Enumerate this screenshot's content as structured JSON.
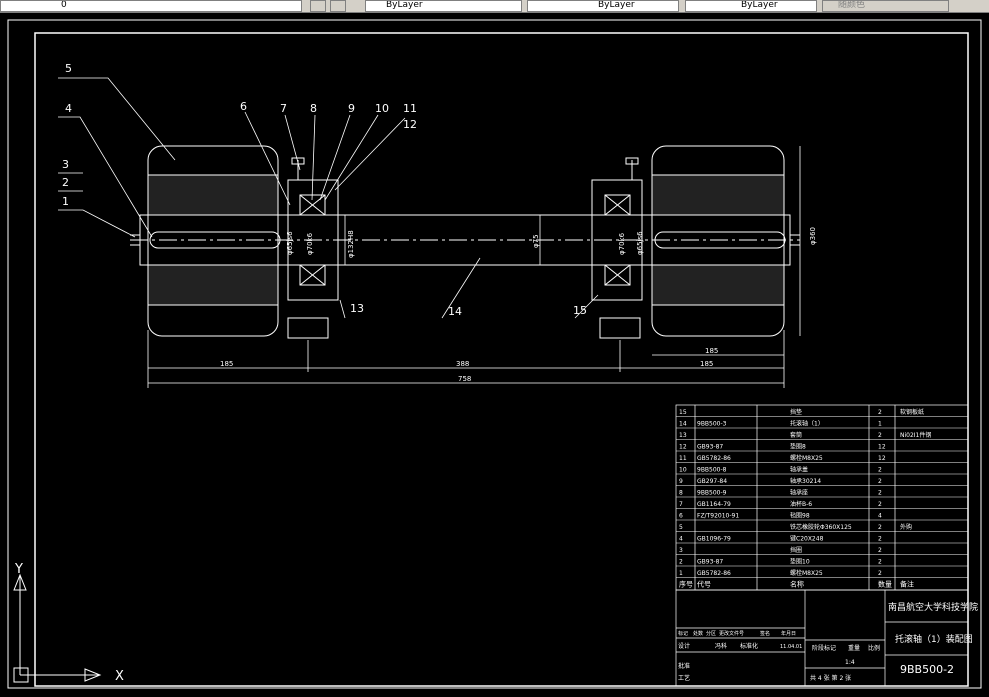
{
  "toolbar": {
    "layer_value": "0",
    "color_value": "ByLayer",
    "linetype_value": "ByLayer",
    "lineweight_value": "ByLayer",
    "plotstyle_value": "随颜色"
  },
  "callouts": [
    "1",
    "2",
    "3",
    "4",
    "5",
    "6",
    "7",
    "8",
    "9",
    "10",
    "11",
    "12",
    "13",
    "14",
    "15"
  ],
  "dimensions": {
    "d_left_bore": "φ65js6",
    "d_left_shaft": "φ70k6",
    "d_center": "φ132H8",
    "d_right_mid": "φ75",
    "d_right_shaft": "φ70k6",
    "d_right_bore": "φ65js6",
    "d_wheel": "φ360",
    "len_left": "185",
    "len_mid": "388",
    "len_right": "185",
    "len_total": "758"
  },
  "parts_list": {
    "rows": [
      {
        "no": "15",
        "code": "",
        "name": "挡垫",
        "qty": "2",
        "material": "软钢板纸"
      },
      {
        "no": "14",
        "code": "9BB500-3",
        "name": "托滚轴（1）",
        "qty": "1",
        "material": ""
      },
      {
        "no": "13",
        "code": "",
        "name": "套筒",
        "qty": "2",
        "material": "Ni02I1件钢"
      },
      {
        "no": "12",
        "code": "GB93-87",
        "name": "垫圈8",
        "qty": "12",
        "material": ""
      },
      {
        "no": "11",
        "code": "GB5782-86",
        "name": "螺栓M8X25",
        "qty": "12",
        "material": ""
      },
      {
        "no": "10",
        "code": "9BB500-8",
        "name": "轴承盖",
        "qty": "2",
        "material": ""
      },
      {
        "no": "9",
        "code": "GB297-84",
        "name": "轴承30214",
        "qty": "2",
        "material": ""
      },
      {
        "no": "8",
        "code": "9BB500-9",
        "name": "轴承座",
        "qty": "2",
        "material": ""
      },
      {
        "no": "7",
        "code": "GB1164-79",
        "name": "油杯B-6",
        "qty": "2",
        "material": ""
      },
      {
        "no": "6",
        "code": "FZ/T92010-91",
        "name": "毡圈98",
        "qty": "4",
        "material": ""
      },
      {
        "no": "5",
        "code": "",
        "name": "铁芯橡胶轮Φ360X125",
        "qty": "2",
        "material": "外购"
      },
      {
        "no": "4",
        "code": "GB1096-79",
        "name": "键C20X248",
        "qty": "2",
        "material": ""
      },
      {
        "no": "3",
        "code": "",
        "name": "挡圈",
        "qty": "2",
        "material": ""
      },
      {
        "no": "2",
        "code": "GB93-87",
        "name": "垫圈10",
        "qty": "2",
        "material": ""
      },
      {
        "no": "1",
        "code": "GB5782-86",
        "name": "螺栓M8X25",
        "qty": "2",
        "material": ""
      }
    ],
    "header": {
      "no": "序号",
      "code": "代号",
      "name": "名称",
      "qty": "数量",
      "material": "备注"
    }
  },
  "title_block": {
    "school": "南昌航空大学科技学院",
    "drawing_title": "托滚轴（1）装配图",
    "drawing_number": "9BB500-2",
    "scale": "1:4",
    "sheets": "共 4 张 第 2 张",
    "stage_label": "阶段标记",
    "weight_label": "重量",
    "scale_label": "比例",
    "designer_label": "设计",
    "designer_name": "冯科",
    "std_label": "标准化",
    "date": "11.04.01",
    "labels": [
      "标记",
      "处数",
      "分区",
      "更改文件号",
      "签名",
      "年月日"
    ],
    "approve_label": "批准",
    "process_label": "工艺"
  },
  "ucs": {
    "x_label": "X",
    "y_label": "Y"
  }
}
